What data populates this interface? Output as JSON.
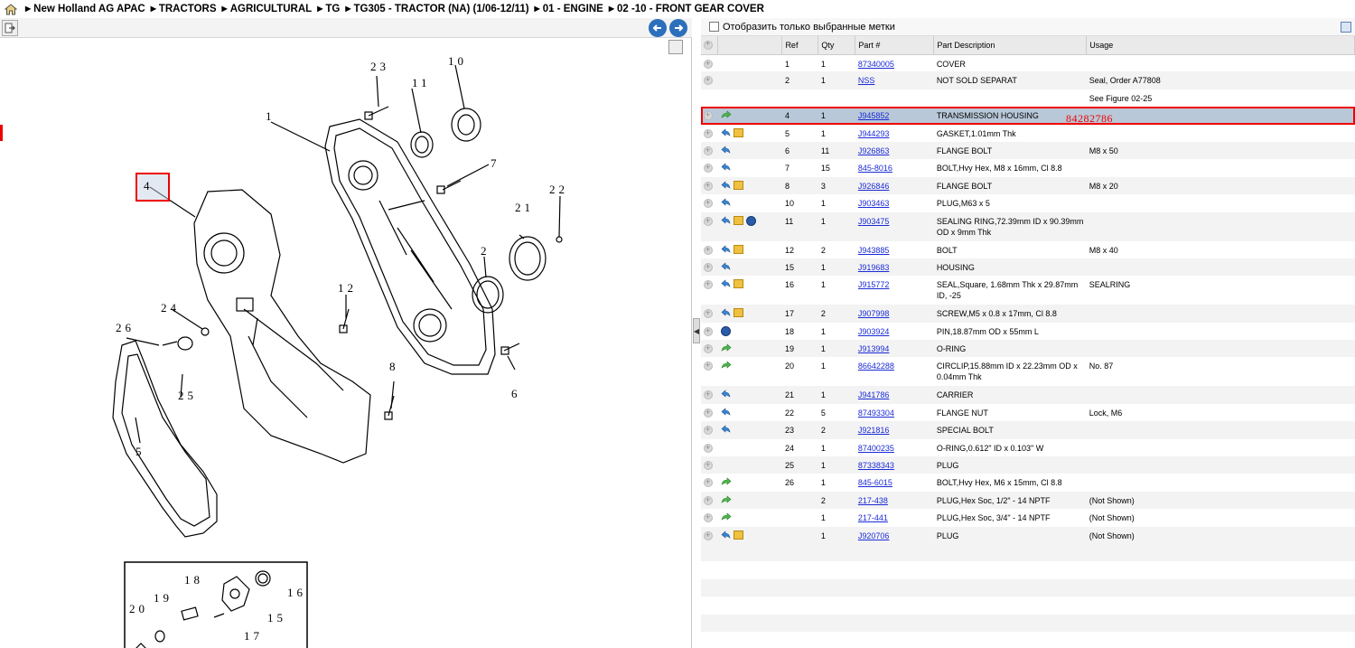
{
  "breadcrumb": {
    "items": [
      "New Holland AG APAC",
      "TRACTORS",
      "AGRICULTURAL",
      "TG",
      "TG305 - TRACTOR (NA) (1/06-12/11)",
      "01 - ENGINE",
      "02 -10 - FRONT GEAR COVER"
    ]
  },
  "filter": {
    "label": "Отобразить только выбранные метки"
  },
  "columns": {
    "ref": "Ref",
    "qty": "Qty",
    "part": "Part #",
    "desc": "Part Description",
    "usage": "Usage"
  },
  "selected_note": "84282786",
  "diagram": {
    "callouts": [
      "1",
      "2",
      "4",
      "5",
      "6",
      "7",
      "8",
      "10",
      "11",
      "12",
      "15",
      "16",
      "17",
      "18",
      "19",
      "20",
      "21",
      "22",
      "23",
      "24",
      "25",
      "26"
    ]
  },
  "parts": [
    {
      "ref": "1",
      "qty": "1",
      "part": "87340005",
      "desc": "COVER",
      "usage": "",
      "icons": []
    },
    {
      "ref": "2",
      "qty": "1",
      "part": "NSS",
      "desc": "NOT SOLD SEPARAT",
      "usage": "Seal, Order A77808",
      "icons": []
    },
    {
      "ref": "",
      "qty": "",
      "part": "",
      "desc": "",
      "usage": "See Figure 02-25",
      "icons": []
    },
    {
      "ref": "4",
      "qty": "1",
      "part": "J945852",
      "desc": "TRANSMISSION HOUSING",
      "usage": "",
      "icons": [
        "green-arrow-icon"
      ],
      "selected": true
    },
    {
      "ref": "5",
      "qty": "1",
      "part": "J944293",
      "desc": "GASKET,1.01mm Thk",
      "usage": "",
      "icons": [
        "blue-arrow-icon",
        "box-icon"
      ]
    },
    {
      "ref": "6",
      "qty": "11",
      "part": "J926863",
      "desc": "FLANGE BOLT",
      "usage": "M8 x 50",
      "icons": [
        "blue-arrow-icon"
      ]
    },
    {
      "ref": "7",
      "qty": "15",
      "part": "845-8016",
      "desc": "BOLT,Hvy Hex, M8 x 16mm, Cl 8.8",
      "usage": "",
      "icons": [
        "blue-arrow-icon"
      ]
    },
    {
      "ref": "8",
      "qty": "3",
      "part": "J926846",
      "desc": "FLANGE BOLT",
      "usage": "M8 x 20",
      "icons": [
        "blue-arrow-icon",
        "box-icon"
      ]
    },
    {
      "ref": "10",
      "qty": "1",
      "part": "J903463",
      "desc": "PLUG,M63 x 5",
      "usage": "",
      "icons": [
        "blue-arrow-icon"
      ]
    },
    {
      "ref": "11",
      "qty": "1",
      "part": "J903475",
      "desc": "SEALING RING,72.39mm ID x 90.39mm OD x 9mm Thk",
      "usage": "",
      "icons": [
        "blue-arrow-icon",
        "box-icon",
        "globe-icon"
      ],
      "tall": true
    },
    {
      "ref": "12",
      "qty": "2",
      "part": "J943885",
      "desc": "BOLT",
      "usage": "M8 x 40",
      "icons": [
        "blue-arrow-icon",
        "box-icon"
      ]
    },
    {
      "ref": "15",
      "qty": "1",
      "part": "J919683",
      "desc": "HOUSING",
      "usage": "",
      "icons": [
        "blue-arrow-icon"
      ]
    },
    {
      "ref": "16",
      "qty": "1",
      "part": "J915772",
      "desc": "SEAL,Square, 1.68mm Thk x 29.87mm ID, -25",
      "usage": "SEALRING",
      "icons": [
        "blue-arrow-icon",
        "box-icon"
      ],
      "tall": true
    },
    {
      "ref": "17",
      "qty": "2",
      "part": "J907998",
      "desc": "SCREW,M5 x 0.8 x 17mm, Cl 8.8",
      "usage": "",
      "icons": [
        "blue-arrow-icon",
        "box-icon"
      ]
    },
    {
      "ref": "18",
      "qty": "1",
      "part": "J903924",
      "desc": "PIN,18.87mm OD x 55mm L",
      "usage": "",
      "icons": [
        "globe-icon"
      ]
    },
    {
      "ref": "19",
      "qty": "1",
      "part": "J913994",
      "desc": "O-RING",
      "usage": "",
      "icons": [
        "green-arrow-icon"
      ]
    },
    {
      "ref": "20",
      "qty": "1",
      "part": "86642288",
      "desc": "CIRCLIP,15.88mm ID x 22.23mm OD x 0.04mm Thk",
      "usage": "No. 87",
      "icons": [
        "green-arrow-icon"
      ],
      "tall": true
    },
    {
      "ref": "21",
      "qty": "1",
      "part": "J941786",
      "desc": "CARRIER",
      "usage": "",
      "icons": [
        "blue-arrow-icon"
      ]
    },
    {
      "ref": "22",
      "qty": "5",
      "part": "87493304",
      "desc": "FLANGE NUT",
      "usage": "Lock, M6",
      "icons": [
        "blue-arrow-icon"
      ]
    },
    {
      "ref": "23",
      "qty": "2",
      "part": "J921816",
      "desc": "SPECIAL BOLT",
      "usage": "",
      "icons": [
        "blue-arrow-icon"
      ]
    },
    {
      "ref": "24",
      "qty": "1",
      "part": "87400235",
      "desc": "O-RING,0.612\" ID x 0.103\" W",
      "usage": "",
      "icons": []
    },
    {
      "ref": "25",
      "qty": "1",
      "part": "87338343",
      "desc": "PLUG",
      "usage": "",
      "icons": []
    },
    {
      "ref": "26",
      "qty": "1",
      "part": "845-6015",
      "desc": "BOLT,Hvy Hex, M6 x 15mm, Cl 8.8",
      "usage": "",
      "icons": [
        "green-arrow-icon"
      ]
    },
    {
      "ref": "",
      "qty": "2",
      "part": "217-438",
      "desc": "PLUG,Hex Soc, 1/2\" - 14 NPTF",
      "usage": "(Not Shown)",
      "icons": [
        "green-arrow-icon"
      ]
    },
    {
      "ref": "",
      "qty": "1",
      "part": "217-441",
      "desc": "PLUG,Hex Soc, 3/4\" - 14 NPTF",
      "usage": "(Not Shown)",
      "icons": [
        "green-arrow-icon"
      ]
    },
    {
      "ref": "",
      "qty": "1",
      "part": "J920706",
      "desc": "PLUG",
      "usage": "(Not Shown)",
      "icons": [
        "blue-arrow-icon",
        "box-icon"
      ]
    }
  ],
  "colors": {
    "link": "#1a2bd6",
    "selected_row": "#b8c8d8",
    "highlight": "#e00000",
    "nav_button": "#2c6fbb"
  }
}
